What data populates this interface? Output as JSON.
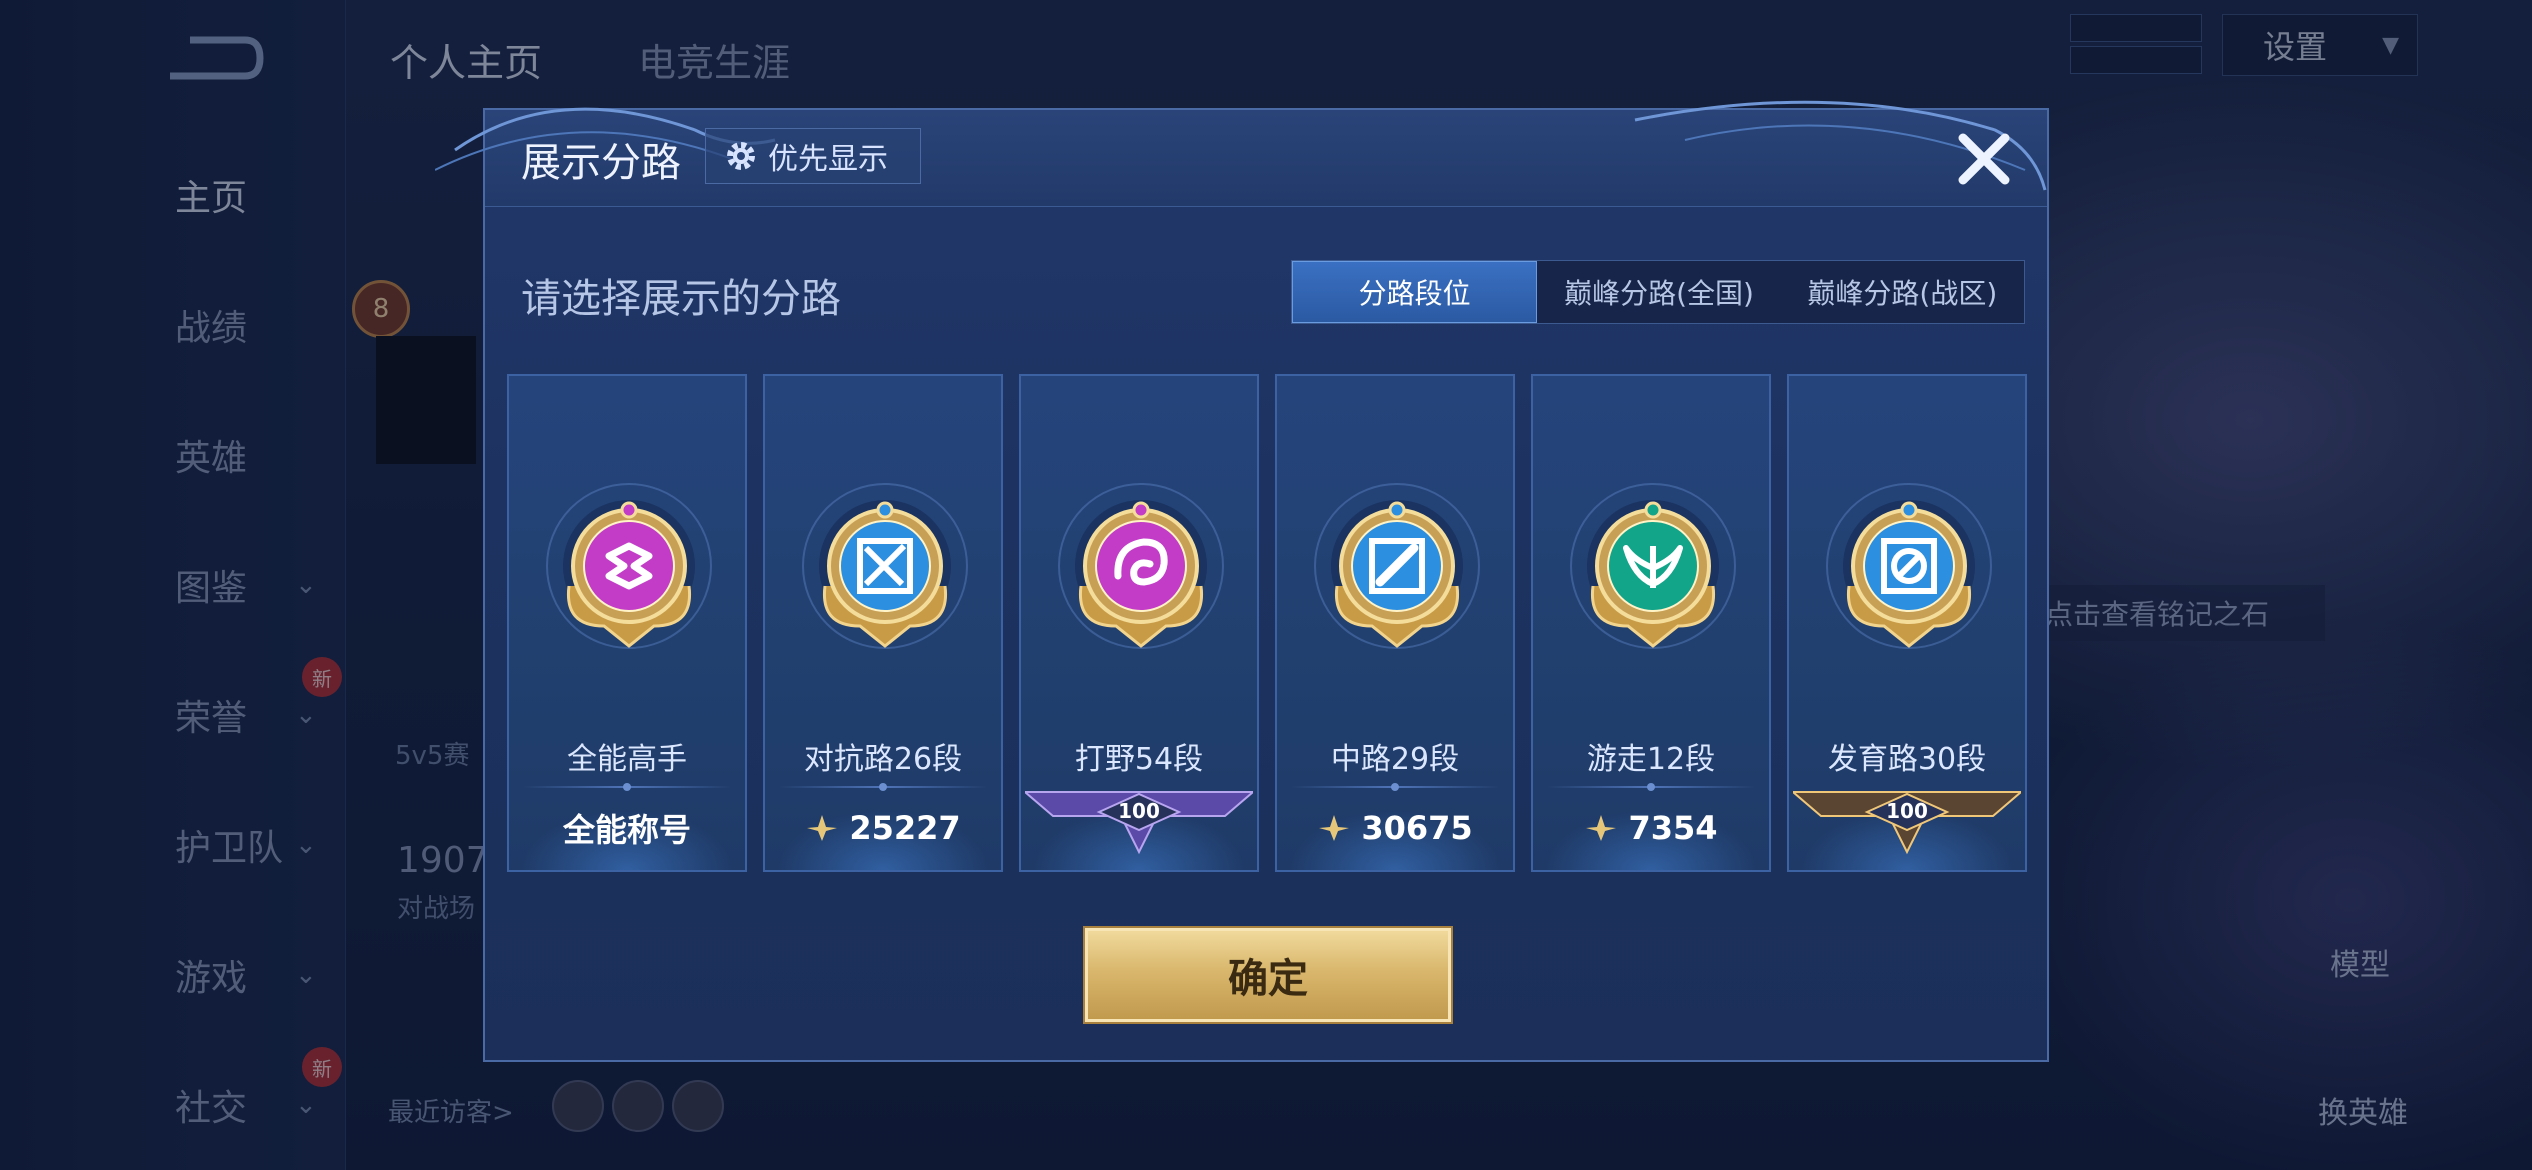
{
  "background": {
    "nav": [
      {
        "label": "主页",
        "active": true,
        "chevron": false
      },
      {
        "label": "战绩",
        "active": false,
        "chevron": false
      },
      {
        "label": "英雄",
        "active": false,
        "chevron": false
      },
      {
        "label": "图鉴",
        "active": false,
        "chevron": true
      },
      {
        "label": "荣誉",
        "active": false,
        "chevron": true,
        "badge": "新"
      },
      {
        "label": "护卫队",
        "active": false,
        "chevron": true
      },
      {
        "label": "游戏",
        "active": false,
        "chevron": true
      },
      {
        "label": "社交",
        "active": false,
        "chevron": true,
        "badge": "新"
      }
    ],
    "top_tabs": [
      "个人主页",
      "电竞生涯"
    ],
    "settings_label": "设置",
    "level": "8",
    "mode_text": "5v5赛",
    "stat_number": "1907",
    "stat_label": "对战场",
    "inscription_hint": "点击查看铭记之石",
    "model_label": "模型",
    "switch_hero_label": "换英雄",
    "recent_visitors_label": "最近访客>"
  },
  "modal": {
    "title": "展示分路",
    "priority_button": "优先显示",
    "subtitle": "请选择展示的分路",
    "tabs": [
      {
        "label": "分路段位",
        "active": true
      },
      {
        "label": "巅峰分路(全国)",
        "active": false
      },
      {
        "label": "巅峰分路(战区)",
        "active": false
      }
    ],
    "cards": [
      {
        "label": "全能高手",
        "value": "全能称号",
        "kind": "text",
        "emblem_color": "#c23cc8",
        "glyph": "all"
      },
      {
        "label": "对抗路26段",
        "value": "25227",
        "kind": "points",
        "emblem_color": "#2d8fe0",
        "glyph": "sword"
      },
      {
        "label": "打野54段",
        "value": "100",
        "kind": "ribbon-purple",
        "emblem_color": "#c23cc8",
        "glyph": "dragon"
      },
      {
        "label": "中路29段",
        "value": "30675",
        "kind": "points",
        "emblem_color": "#2d8fe0",
        "glyph": "mid"
      },
      {
        "label": "游走12段",
        "value": "7354",
        "kind": "points",
        "emblem_color": "#12a58a",
        "glyph": "wing"
      },
      {
        "label": "发育路30段",
        "value": "100",
        "kind": "ribbon-gold",
        "emblem_color": "#2d8fe0",
        "glyph": "adc"
      }
    ],
    "confirm_button": "确定"
  }
}
